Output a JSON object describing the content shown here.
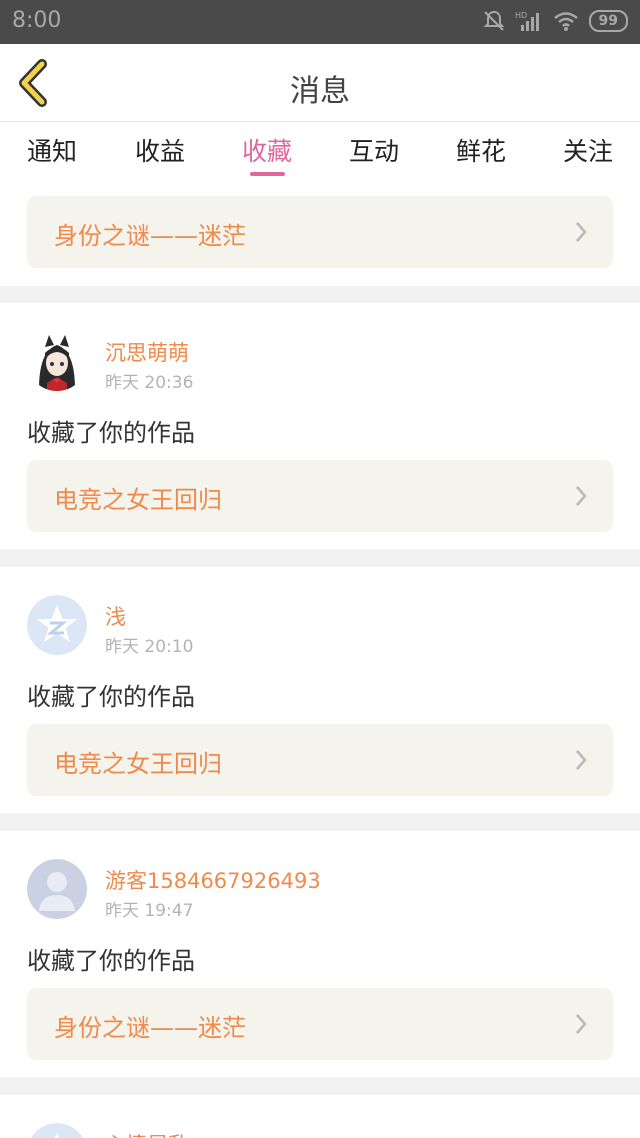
{
  "status_bar": {
    "time": "8:00",
    "battery": "99",
    "icons": [
      "mute-bell-icon",
      "hd-signal-icon",
      "wifi-icon",
      "battery-icon"
    ]
  },
  "header": {
    "title": "消息",
    "back_icon": "chevron-left-icon"
  },
  "tabs": [
    {
      "label": "通知",
      "active": false
    },
    {
      "label": "收益",
      "active": false
    },
    {
      "label": "收藏",
      "active": true
    },
    {
      "label": "互动",
      "active": false
    },
    {
      "label": "鲜花",
      "active": false
    },
    {
      "label": "关注",
      "active": false
    }
  ],
  "messages": [
    {
      "work_title": "身份之谜——迷茫"
    },
    {
      "user": "沉思萌萌",
      "time": "昨天 20:36",
      "action": "收藏了你的作品",
      "work_title": "电竞之女王回归",
      "avatar": "anime-girl-avatar"
    },
    {
      "user": "浅",
      "time": "昨天 20:10",
      "action": "收藏了你的作品",
      "work_title": "电竞之女王回归",
      "avatar": "qzone-star-avatar"
    },
    {
      "user": "游客1584667926493",
      "time": "昨天 19:47",
      "action": "收藏了你的作品",
      "work_title": "身份之谜——迷茫",
      "avatar": "default-person-avatar"
    },
    {
      "user": "心情昼乱",
      "avatar": "qzone-star-avatar"
    }
  ],
  "colors": {
    "accent": "#e0679e",
    "orange": "#ee8a4c",
    "work_box_bg": "#f4f3ec",
    "status_bar": "#4a4a4a",
    "back_arrow": "#f2d24a"
  }
}
